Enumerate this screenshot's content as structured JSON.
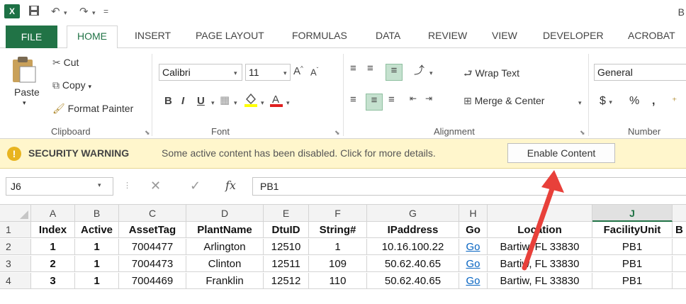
{
  "titlebar": {
    "title_fragment": "B",
    "logo": "X"
  },
  "tabs": [
    "FILE",
    "HOME",
    "INSERT",
    "PAGE LAYOUT",
    "FORMULAS",
    "DATA",
    "REVIEW",
    "VIEW",
    "DEVELOPER",
    "ACROBAT"
  ],
  "clipboard": {
    "paste": "Paste",
    "cut": "Cut",
    "copy": "Copy",
    "format_painter": "Format Painter",
    "label": "Clipboard"
  },
  "font": {
    "name": "Calibri",
    "size": "11",
    "label": "Font"
  },
  "alignment": {
    "wrap": "Wrap Text",
    "merge": "Merge & Center",
    "label": "Alignment"
  },
  "number": {
    "format": "General",
    "label": "Number",
    "currency": "$",
    "percent": "%",
    "comma": ","
  },
  "security": {
    "title": "SECURITY WARNING",
    "message": "Some active content has been disabled. Click for more details.",
    "button": "Enable Content"
  },
  "formula": {
    "namebox": "J6",
    "value": "PB1",
    "fx": "fx"
  },
  "columns": [
    "A",
    "B",
    "C",
    "D",
    "E",
    "F",
    "G",
    "H",
    "I",
    "J"
  ],
  "rows": [
    {
      "num": "1",
      "cells": [
        "Index",
        "Active",
        "AssetTag",
        "PlantName",
        "DtuID",
        "String#",
        "IPaddress",
        "Go",
        "Location",
        "FacilityUnit",
        "B"
      ]
    },
    {
      "num": "2",
      "cells": [
        "1",
        "1",
        "7004477",
        "Arlington",
        "12510",
        "1",
        "10.16.100.22",
        "Go",
        "Bartiw, FL 33830",
        "PB1",
        ""
      ]
    },
    {
      "num": "3",
      "cells": [
        "2",
        "1",
        "7004473",
        "Clinton",
        "12511",
        "109",
        "50.62.40.65",
        "Go",
        "Bartiw, FL 33830",
        "PB1",
        ""
      ]
    },
    {
      "num": "4",
      "cells": [
        "3",
        "1",
        "7004469",
        "Franklin",
        "12512",
        "110",
        "50.62.40.65",
        "Go",
        "Bartiw, FL 33830",
        "PB1",
        ""
      ]
    }
  ],
  "colors": {
    "excel_green": "#217346",
    "warning_bg": "#fff6cc",
    "arrow": "#e8403a",
    "link": "#0563c1"
  }
}
